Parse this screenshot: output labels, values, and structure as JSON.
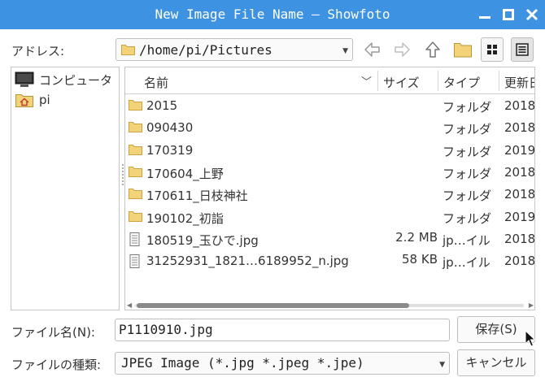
{
  "window": {
    "title": "New Image File Name — Showfoto"
  },
  "address": {
    "label": "アドレス:",
    "path": "/home/pi/Pictures"
  },
  "places": [
    {
      "label": "コンピュータ",
      "icon": "computer-icon"
    },
    {
      "label": "pi",
      "icon": "home-folder-icon"
    }
  ],
  "columns": {
    "name": "名前",
    "size": "サイズ",
    "type": "タイプ",
    "date": "更新日"
  },
  "files": [
    {
      "name": "2015",
      "size": "",
      "type": "フォルダ",
      "date": "2018",
      "icon": "folder-icon"
    },
    {
      "name": "090430",
      "size": "",
      "type": "フォルダ",
      "date": "2018",
      "icon": "folder-icon"
    },
    {
      "name": "170319",
      "size": "",
      "type": "フォルダ",
      "date": "2019",
      "icon": "folder-icon"
    },
    {
      "name": "170604_上野",
      "size": "",
      "type": "フォルダ",
      "date": "2018",
      "icon": "folder-icon"
    },
    {
      "name": "170611_日枝神社",
      "size": "",
      "type": "フォルダ",
      "date": "2018",
      "icon": "folder-icon"
    },
    {
      "name": "190102_初詣",
      "size": "",
      "type": "フォルダ",
      "date": "2019",
      "icon": "folder-icon"
    },
    {
      "name": "180519_玉ひで.jpg",
      "size": "2.2 MB",
      "type": "jp…イル",
      "date": "2018",
      "icon": "file-icon"
    },
    {
      "name": "31252931_1821…6189952_n.jpg",
      "size": "58 KB",
      "type": "jp…イル",
      "date": "2018",
      "icon": "file-icon"
    }
  ],
  "filename": {
    "label": "ファイル名(N):",
    "value": "P1110910.jpg"
  },
  "filetype": {
    "label": "ファイルの種類:",
    "value": "JPEG Image (*.jpg *.jpeg *.jpe)"
  },
  "buttons": {
    "save": "保存(S)",
    "cancel": "キャンセル"
  },
  "colors": {
    "titlebar": "#3d93e1",
    "folder": "#f3d37a"
  }
}
